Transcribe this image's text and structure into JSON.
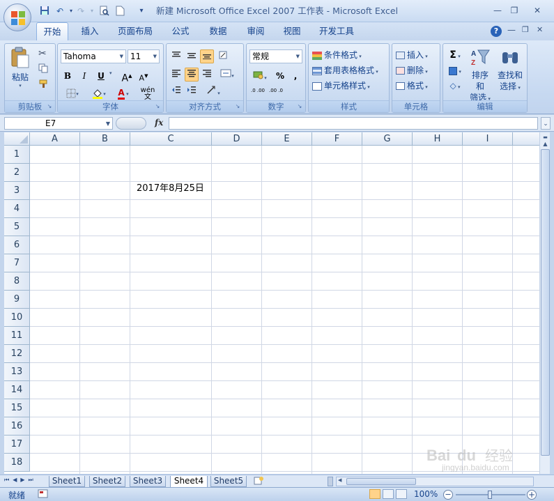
{
  "window": {
    "title": "新建 Microsoft Office Excel 2007 工作表 - Microsoft Excel",
    "minimize_glyph": "—",
    "restore_glyph": "❐",
    "close_glyph": "✕"
  },
  "quick_access": {
    "save_icon": "save-icon",
    "undo_icon": "undo-icon",
    "redo_icon": "redo-icon",
    "print_preview_icon": "print-preview-icon",
    "new_icon": "new-icon",
    "customize_glyph": "▾"
  },
  "tabs": [
    {
      "label": "开始",
      "active": true
    },
    {
      "label": "插入"
    },
    {
      "label": "页面布局"
    },
    {
      "label": "公式"
    },
    {
      "label": "数据"
    },
    {
      "label": "审阅"
    },
    {
      "label": "视图"
    },
    {
      "label": "开发工具"
    }
  ],
  "ribbon": {
    "clipboard": {
      "label": "剪贴板",
      "paste": "粘贴"
    },
    "font": {
      "label": "字体",
      "font_name": "Tahoma",
      "font_size": "11",
      "bold": "B",
      "italic": "I",
      "underline": "U",
      "grow": "A",
      "shrink": "A",
      "wen": "wén 文",
      "font_color_glyph": "A"
    },
    "alignment": {
      "label": "对齐方式"
    },
    "number": {
      "label": "数字",
      "format": "常规",
      "percent": "%",
      "comma": ",",
      "inc_decimal": ".0 .00",
      "dec_decimal": ".00 .0"
    },
    "styles": {
      "label": "样式",
      "conditional": "条件格式",
      "as_table": "套用表格格式",
      "cell_styles": "单元格样式"
    },
    "cells": {
      "label": "单元格",
      "insert": "插入",
      "delete": "删除",
      "format": "格式"
    },
    "editing": {
      "label": "编辑",
      "sum_glyph": "Σ",
      "sort_filter_1": "排序和",
      "sort_filter_2": "筛选",
      "find_select_1": "查找和",
      "find_select_2": "选择"
    }
  },
  "formula_bar": {
    "name_box": "E7",
    "fx": "fx",
    "content": ""
  },
  "sheet": {
    "columns": [
      "A",
      "B",
      "C",
      "D",
      "E",
      "F",
      "G",
      "H",
      "I"
    ],
    "rows": [
      "1",
      "2",
      "3",
      "4",
      "5",
      "6",
      "7",
      "8",
      "9",
      "10",
      "11",
      "12",
      "13",
      "14",
      "15",
      "16",
      "17",
      "18"
    ],
    "cells": {
      "C3": "2017年8月25日"
    }
  },
  "sheet_tabs": [
    {
      "label": "Sheet1"
    },
    {
      "label": "Sheet2"
    },
    {
      "label": "Sheet3"
    },
    {
      "label": "Sheet4",
      "active": true
    },
    {
      "label": "Sheet5"
    }
  ],
  "status": {
    "mode": "就绪",
    "zoom": "100%"
  },
  "watermark": {
    "brand": "Baidu 经验",
    "url": "jingyan.baidu.com"
  },
  "colors": {
    "accent": "#15428b",
    "ribbon_bg": "#c7d9f1",
    "grid_line": "#d0d7e5",
    "highlight": "#ffd38a"
  }
}
